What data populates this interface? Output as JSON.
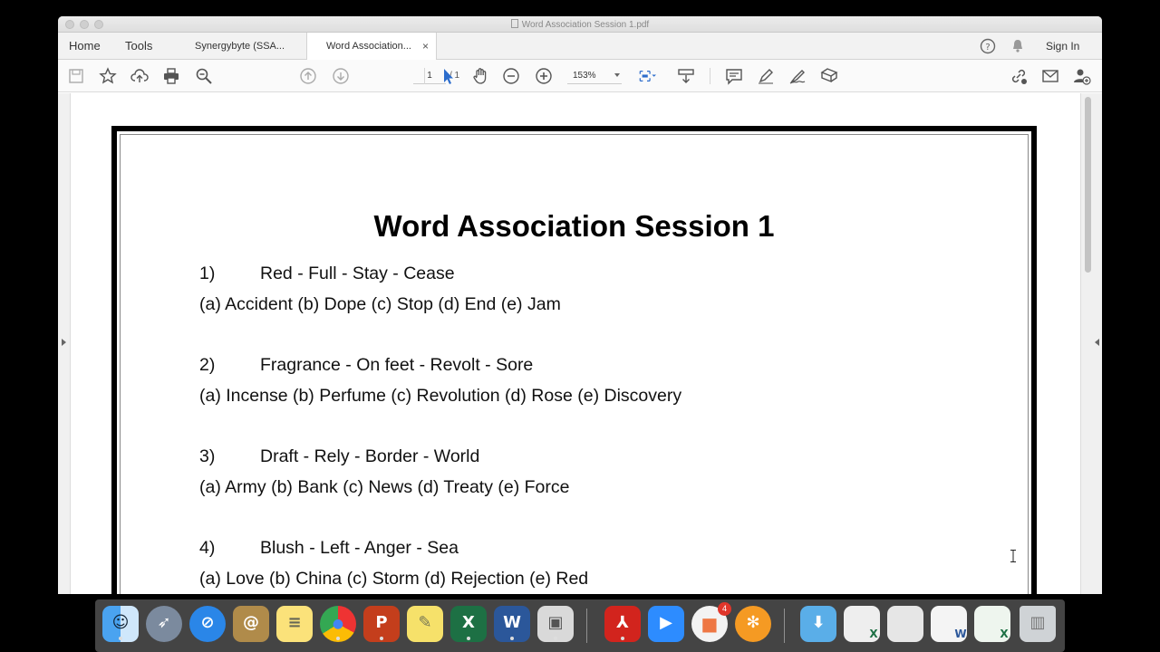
{
  "window": {
    "title": "Word Association Session 1.pdf"
  },
  "tabs": {
    "home": "Home",
    "tools": "Tools",
    "docs": [
      {
        "label": "Synergybyte (SSA..."
      },
      {
        "label": "Word Association...",
        "close": "×"
      }
    ],
    "help_icon": "question-circle-icon",
    "notifications_icon": "bell-icon",
    "sign_in": "Sign In"
  },
  "toolbar": {
    "page_current": "1",
    "page_total": "/ 1",
    "zoom": "153%",
    "icons": [
      "save-icon",
      "bookmark-star-icon",
      "upload-cloud-icon",
      "print-icon",
      "search-zoom-icon",
      "page-up-icon",
      "page-down-icon",
      "select-arrow-icon",
      "hand-icon",
      "zoom-out-icon",
      "zoom-in-icon",
      "fit-page-icon",
      "scroll-mode-icon",
      "comment-icon",
      "highlight-icon",
      "sign-icon",
      "fill-sign-icon",
      "share-link-icon",
      "email-icon",
      "add-user-icon"
    ]
  },
  "document": {
    "title": "Word Association Session 1",
    "questions": [
      {
        "num": "1)",
        "words": "Red - Full - Stay - Cease",
        "options": "(a) Accident (b) Dope (c) Stop (d) End (e) Jam"
      },
      {
        "num": "2)",
        "words": "Fragrance - On feet - Revolt - Sore",
        "options": "(a) Incense (b) Perfume (c) Revolution (d) Rose (e) Discovery"
      },
      {
        "num": "3)",
        "words": "Draft - Rely - Border - World",
        "options": "(a) Army (b) Bank (c) News (d) Treaty (e) Force"
      },
      {
        "num": "4)",
        "words": "Blush - Left - Anger - Sea",
        "options": "(a) Love (b) China (c) Storm (d) Rejection (e) Red"
      }
    ]
  },
  "dock": {
    "apps": [
      "finder-icon",
      "launchpad-icon",
      "safari-icon",
      "contacts-icon",
      "notes-icon",
      "chrome-icon",
      "powerpoint-icon",
      "stickies-icon",
      "excel-icon",
      "word-icon",
      "preview-icon",
      "acrobat-icon",
      "zoom-icon",
      "microsoft-office-icon",
      "photos-flower-icon",
      "downloads-folder-icon",
      "excel-doc-icon",
      "doc-preview-icon",
      "word-doc-icon",
      "excel-doc2-icon",
      "trash-icon"
    ],
    "office_badge": "4"
  },
  "colors": {
    "accent": "#2d6dcc",
    "acrobat_red": "#d2241d"
  }
}
